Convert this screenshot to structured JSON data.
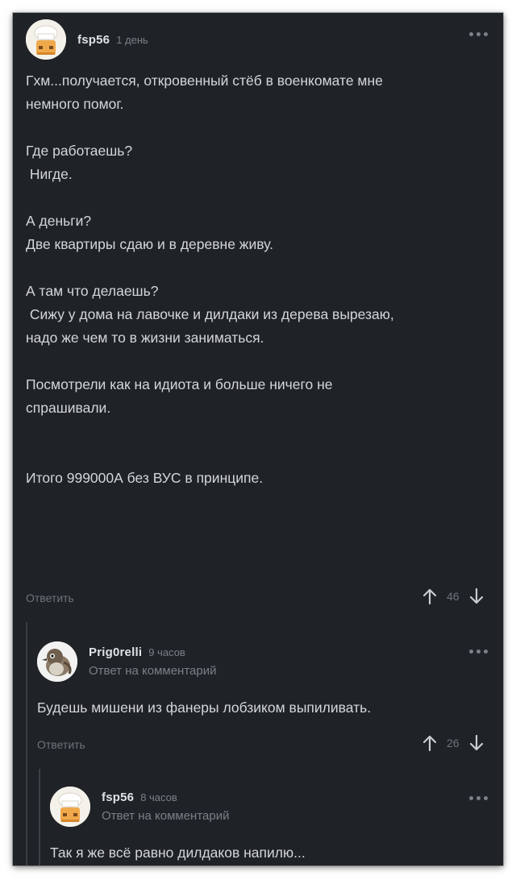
{
  "comments": [
    {
      "username": "fsp56",
      "time": "1 день",
      "body": [
        "Гхм...получается, откровенный стёб в военкомате мне",
        "немного помог.",
        "",
        "Где работаешь?",
        " Нигде.",
        "",
        "А деньги?",
        "Две квартиры сдаю и в деревне живу.",
        "",
        "А там что делаешь?",
        " Сижу у дома на лавочке и дилдаки из дерева вырезаю,",
        "надо же чем то в жизни заниматься.",
        "",
        "Посмотрели как на идиота и больше ничего не",
        "спрашивали.",
        "",
        "",
        "Итого 999000А без ВУС в принципе."
      ],
      "reply_label": "Ответить",
      "votes": "46"
    },
    {
      "username": "Prig0relli",
      "time": "9 часов",
      "reply_to": "Ответ на комментарий",
      "body": [
        "Будешь мишени из фанеры лобзиком выпиливать."
      ],
      "reply_label": "Ответить",
      "votes": "26"
    },
    {
      "username": "fsp56",
      "time": "8 часов",
      "reply_to": "Ответ на комментарий",
      "body": [
        "Так я же всё равно дилдаков напилю..."
      ]
    }
  ],
  "icons": {
    "more": "more-dots-icon",
    "upvote": "arrow-up-icon",
    "downvote": "arrow-down-icon"
  },
  "colors": {
    "background": "#1f2226",
    "text": "#d3d6da",
    "muted": "#7b8188",
    "thread_line": "#3b3f45"
  }
}
